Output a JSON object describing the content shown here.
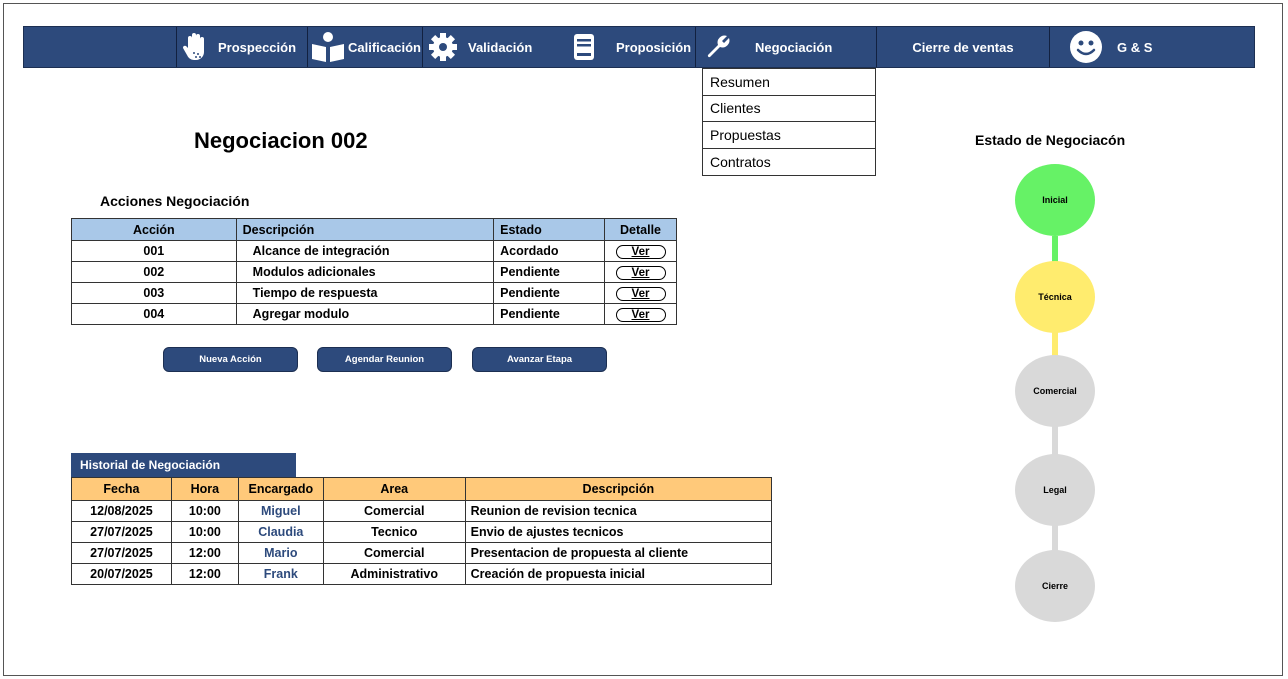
{
  "nav": {
    "items": [
      {
        "label": "Prospección",
        "icon": "hand-icon"
      },
      {
        "label": "Calificación",
        "icon": "reader-icon"
      },
      {
        "label": "Validación",
        "icon": "gear-icon"
      },
      {
        "label": "Proposición",
        "icon": "book-icon"
      },
      {
        "label": "Negociación",
        "icon": "wrench-icon"
      },
      {
        "label": "Cierre de ventas"
      },
      {
        "label": "G & S",
        "icon": "smiley-icon"
      }
    ]
  },
  "dropdown": {
    "items": [
      "Resumen",
      "Clientes",
      "Propuestas",
      "Contratos"
    ]
  },
  "page": {
    "title": "Negociacion 002",
    "actions_title": "Acciones Negociación"
  },
  "actions_table": {
    "headers": [
      "Acción",
      "Descripción",
      "Estado",
      "Detalle"
    ],
    "rows": [
      {
        "accion": "001",
        "descripcion": "Alcance de integración",
        "estado": "Acordado",
        "detalle": "Ver"
      },
      {
        "accion": "002",
        "descripcion": "Modulos adicionales",
        "estado": "Pendiente",
        "detalle": "Ver"
      },
      {
        "accion": "003",
        "descripcion": "Tiempo de respuesta",
        "estado": "Pendiente",
        "detalle": "Ver"
      },
      {
        "accion": "004",
        "descripcion": "Agregar modulo",
        "estado": "Pendiente",
        "detalle": "Ver"
      }
    ]
  },
  "buttons": {
    "nueva": "Nueva Acción",
    "agendar": "Agendar Reunion",
    "avanzar": "Avanzar Etapa"
  },
  "history": {
    "tab_label": "Historial de Negociación",
    "headers": [
      "Fecha",
      "Hora",
      "Encargado",
      "Area",
      "Descripción"
    ],
    "rows": [
      {
        "fecha": "12/08/2025",
        "hora": "10:00",
        "encargado": "Miguel",
        "area": "Comercial",
        "descripcion": "Reunion de revision tecnica"
      },
      {
        "fecha": "27/07/2025",
        "hora": "10:00",
        "encargado": "Claudia",
        "area": "Tecnico",
        "descripcion": "Envio de ajustes tecnicos"
      },
      {
        "fecha": "27/07/2025",
        "hora": "12:00",
        "encargado": "Mario",
        "area": "Comercial",
        "descripcion": "Presentacion de propuesta al cliente"
      },
      {
        "fecha": "20/07/2025",
        "hora": "12:00",
        "encargado": "Frank",
        "area": "Administrativo",
        "descripcion": "Creación de propuesta inicial"
      }
    ]
  },
  "status": {
    "title": "Estado de Negociacón",
    "stages": [
      {
        "label": "Inicial",
        "color": "#66f266"
      },
      {
        "label": "Técnica",
        "color": "#ffec6e"
      },
      {
        "label": "Comercial",
        "color": "#d9d9d9"
      },
      {
        "label": "Legal",
        "color": "#d9d9d9"
      },
      {
        "label": "Cierre",
        "color": "#d9d9d9"
      }
    ]
  },
  "colors": {
    "nav_bg": "#2d4a7c",
    "actions_header": "#a9c8e8",
    "history_header": "#ffc97a"
  }
}
